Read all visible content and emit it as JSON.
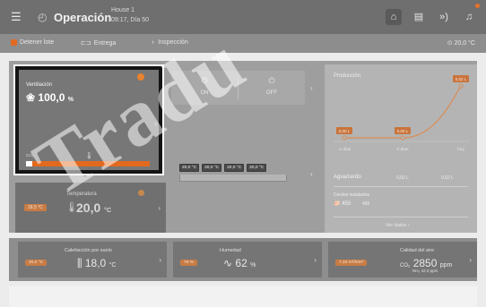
{
  "header": {
    "menu_icon": "hamburger-icon",
    "title_icon": "operation-icon",
    "title": "Operación",
    "house": "House 1",
    "day_info": "09:17, Día 50",
    "icons": [
      "home-icon",
      "clipboard-icon",
      "signal-icon",
      "bell-icon"
    ]
  },
  "actions": {
    "stop_label": "Detener lote",
    "delivery_label": "Entrega",
    "inspection_label": "Inspección",
    "outside_temp": "20,0 °C"
  },
  "ventilation": {
    "label": "Ventilación",
    "value": "100,0",
    "unit": "%",
    "co2_label": "CO₂",
    "level_percent": 5
  },
  "temperature": {
    "label": "Temperatura",
    "setpoint": "18,5 °C",
    "value": "20,0",
    "unit": "°C"
  },
  "switch": {
    "on_label": "ON",
    "off_label": "OFF"
  },
  "feeder": {
    "tags": [
      "20,0 °C",
      "20,0 °C",
      "20,0 °C",
      "20,0 °C"
    ]
  },
  "production": {
    "title": "Producción",
    "chart_data": {
      "type": "line",
      "x": [
        "-1 días",
        "0 días",
        "hoy"
      ],
      "values": [
        0.0,
        0.0,
        0.02
      ],
      "value_labels": [
        "0,00 L",
        "0,00 L",
        "0,02 L"
      ]
    },
    "water_label": "Agua/cerdo",
    "water_prev": "0,02 L",
    "water_today": "0,02 L",
    "pigs_label": "Cerdos instalados",
    "pigs_count": "450",
    "pigs_sub": "450",
    "more_link": "Ver datos"
  },
  "bottom": {
    "floor_heating": {
      "label": "Calefacción por suelo",
      "setpoint": "20,0 °C",
      "value": "18,0",
      "unit": "°C"
    },
    "humidity": {
      "label": "Humedad",
      "setpoint": "75 %",
      "value": "62",
      "unit": "%"
    },
    "air_quality": {
      "label": "Calidad del aire",
      "setpoint": "7,10 m³/h/m²",
      "value_prefix": "CO₂",
      "value": "2850",
      "unit": "ppm",
      "sub": "NH₃ 42,0 ppm"
    }
  },
  "watermark": "Tradu"
}
